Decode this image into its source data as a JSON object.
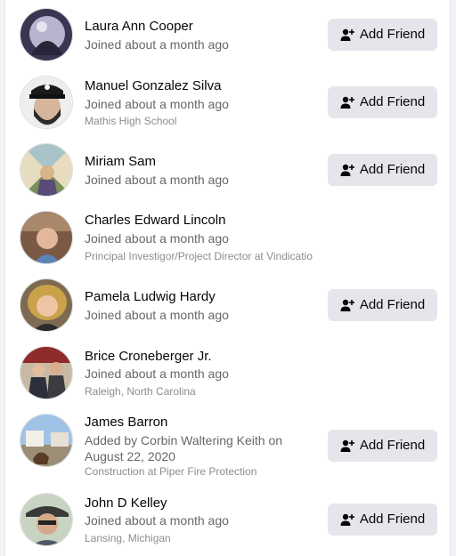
{
  "people": [
    {
      "name": "Laura Ann Cooper",
      "status": "Joined about a month ago",
      "detail": "",
      "button": "Add Friend"
    },
    {
      "name": "Manuel Gonzalez Silva",
      "status": "Joined about a month ago",
      "detail": "Mathis High School",
      "button": "Add Friend"
    },
    {
      "name": "Miriam Sam",
      "status": "Joined about a month ago",
      "detail": "",
      "button": "Add Friend"
    },
    {
      "name": "Charles Edward Lincoln",
      "status": "Joined about a month ago",
      "detail": "Principal Investigor/Project Director at Vindicatio",
      "button": ""
    },
    {
      "name": "Pamela Ludwig Hardy",
      "status": "Joined about a month ago",
      "detail": "",
      "button": "Add Friend"
    },
    {
      "name": "Brice Croneberger Jr.",
      "status": "Joined about a month ago",
      "detail": "Raleigh, North Carolina",
      "button": ""
    },
    {
      "name": "James Barron",
      "status": "Added by Corbin Waltering Keith on August 22, 2020",
      "detail": "Construction at Piper Fire Protection",
      "button": "Add Friend"
    },
    {
      "name": "John D Kelley",
      "status": "Joined about a month ago",
      "detail": "Lansing, Michigan",
      "button": "Add Friend"
    }
  ],
  "icons": {
    "add_friend": "person-plus-icon"
  },
  "colors": {
    "button_bg": "#e4e6eb",
    "name_text": "#050505",
    "secondary_text": "#65676b"
  }
}
